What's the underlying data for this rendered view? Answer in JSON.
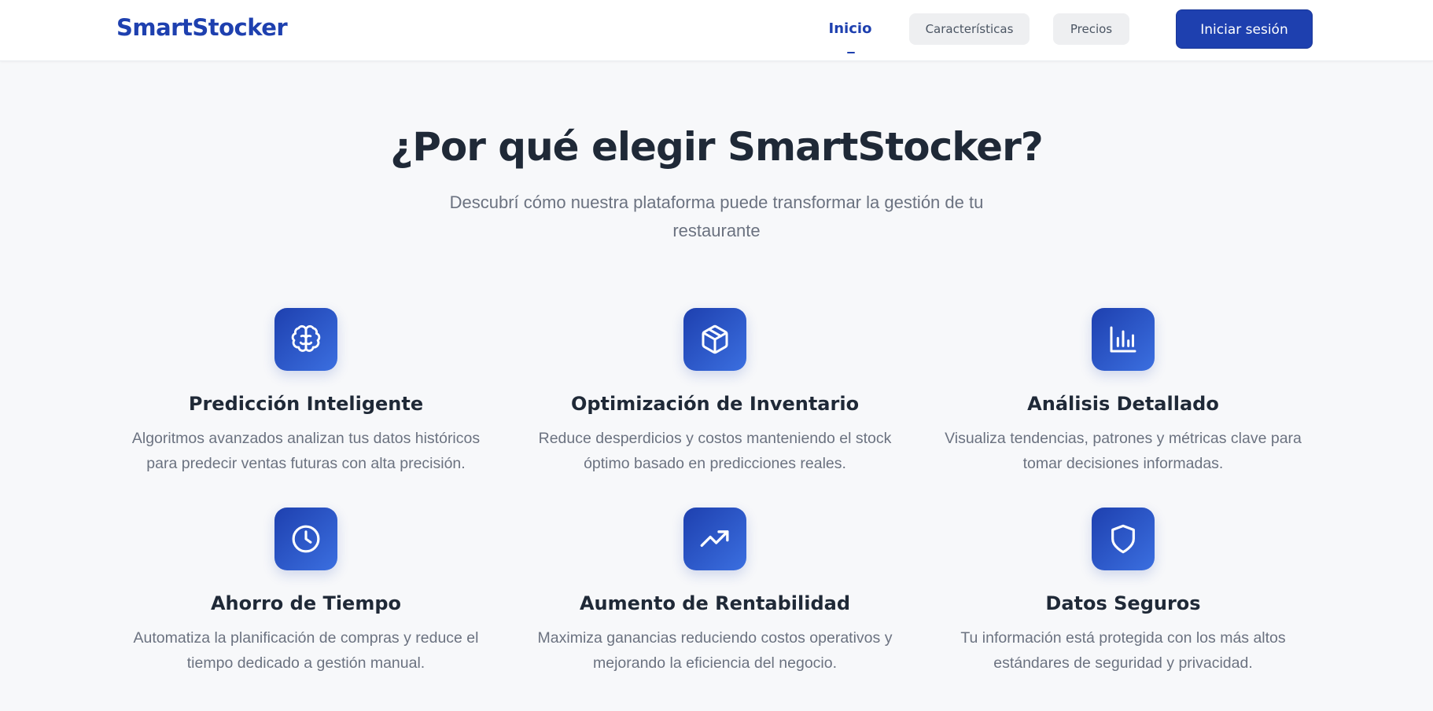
{
  "header": {
    "logo": "SmartStocker",
    "nav": {
      "inicio": "Inicio",
      "caracteristicas": "Características",
      "precios": "Precios"
    },
    "login_label": "Iniciar sesión"
  },
  "hero": {
    "title": "¿Por qué elegir SmartStocker?",
    "subtitle": "Descubrí cómo nuestra plataforma puede transformar la gestión de tu restaurante"
  },
  "features": [
    {
      "icon": "brain-icon",
      "title": "Predicción Inteligente",
      "description": "Algoritmos avanzados analizan tus datos históricos para predecir ventas futuras con alta precisión."
    },
    {
      "icon": "package-icon",
      "title": "Optimización de Inventario",
      "description": "Reduce desperdicios y costos manteniendo el stock óptimo basado en predicciones reales."
    },
    {
      "icon": "bar-chart-icon",
      "title": "Análisis Detallado",
      "description": "Visualiza tendencias, patrones y métricas clave para tomar decisiones informadas."
    },
    {
      "icon": "clock-icon",
      "title": "Ahorro de Tiempo",
      "description": "Automatiza la planificación de compras y reduce el tiempo dedicado a gestión manual."
    },
    {
      "icon": "trending-up-icon",
      "title": "Aumento de Rentabilidad",
      "description": "Maximiza ganancias reduciendo costos operativos y mejorando la eficiencia del negocio."
    },
    {
      "icon": "shield-icon",
      "title": "Datos Seguros",
      "description": "Tu información está protegida con los más altos estándares de seguridad y privacidad."
    }
  ],
  "colors": {
    "primary": "#1e40af",
    "icon_gradient_end": "#3b6fe0",
    "background": "#f7f8fa",
    "heading": "#1f2937",
    "muted_text": "#6b7280"
  }
}
